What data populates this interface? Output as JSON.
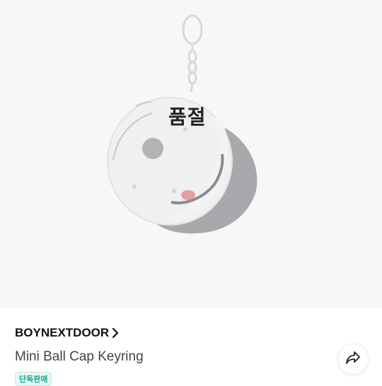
{
  "product": {
    "status_overlay": "품절",
    "brand": "BOYNEXTDOOR",
    "name": "Mini Ball Cap Keyring",
    "badge": "단독판매"
  },
  "icons": {
    "brand_link": "chevron-right-icon",
    "share": "share-arrow-icon"
  },
  "colors": {
    "hero_bg": "#f7f7f8",
    "badge_text": "#17a88d",
    "badge_bg": "#e7f8f4"
  }
}
